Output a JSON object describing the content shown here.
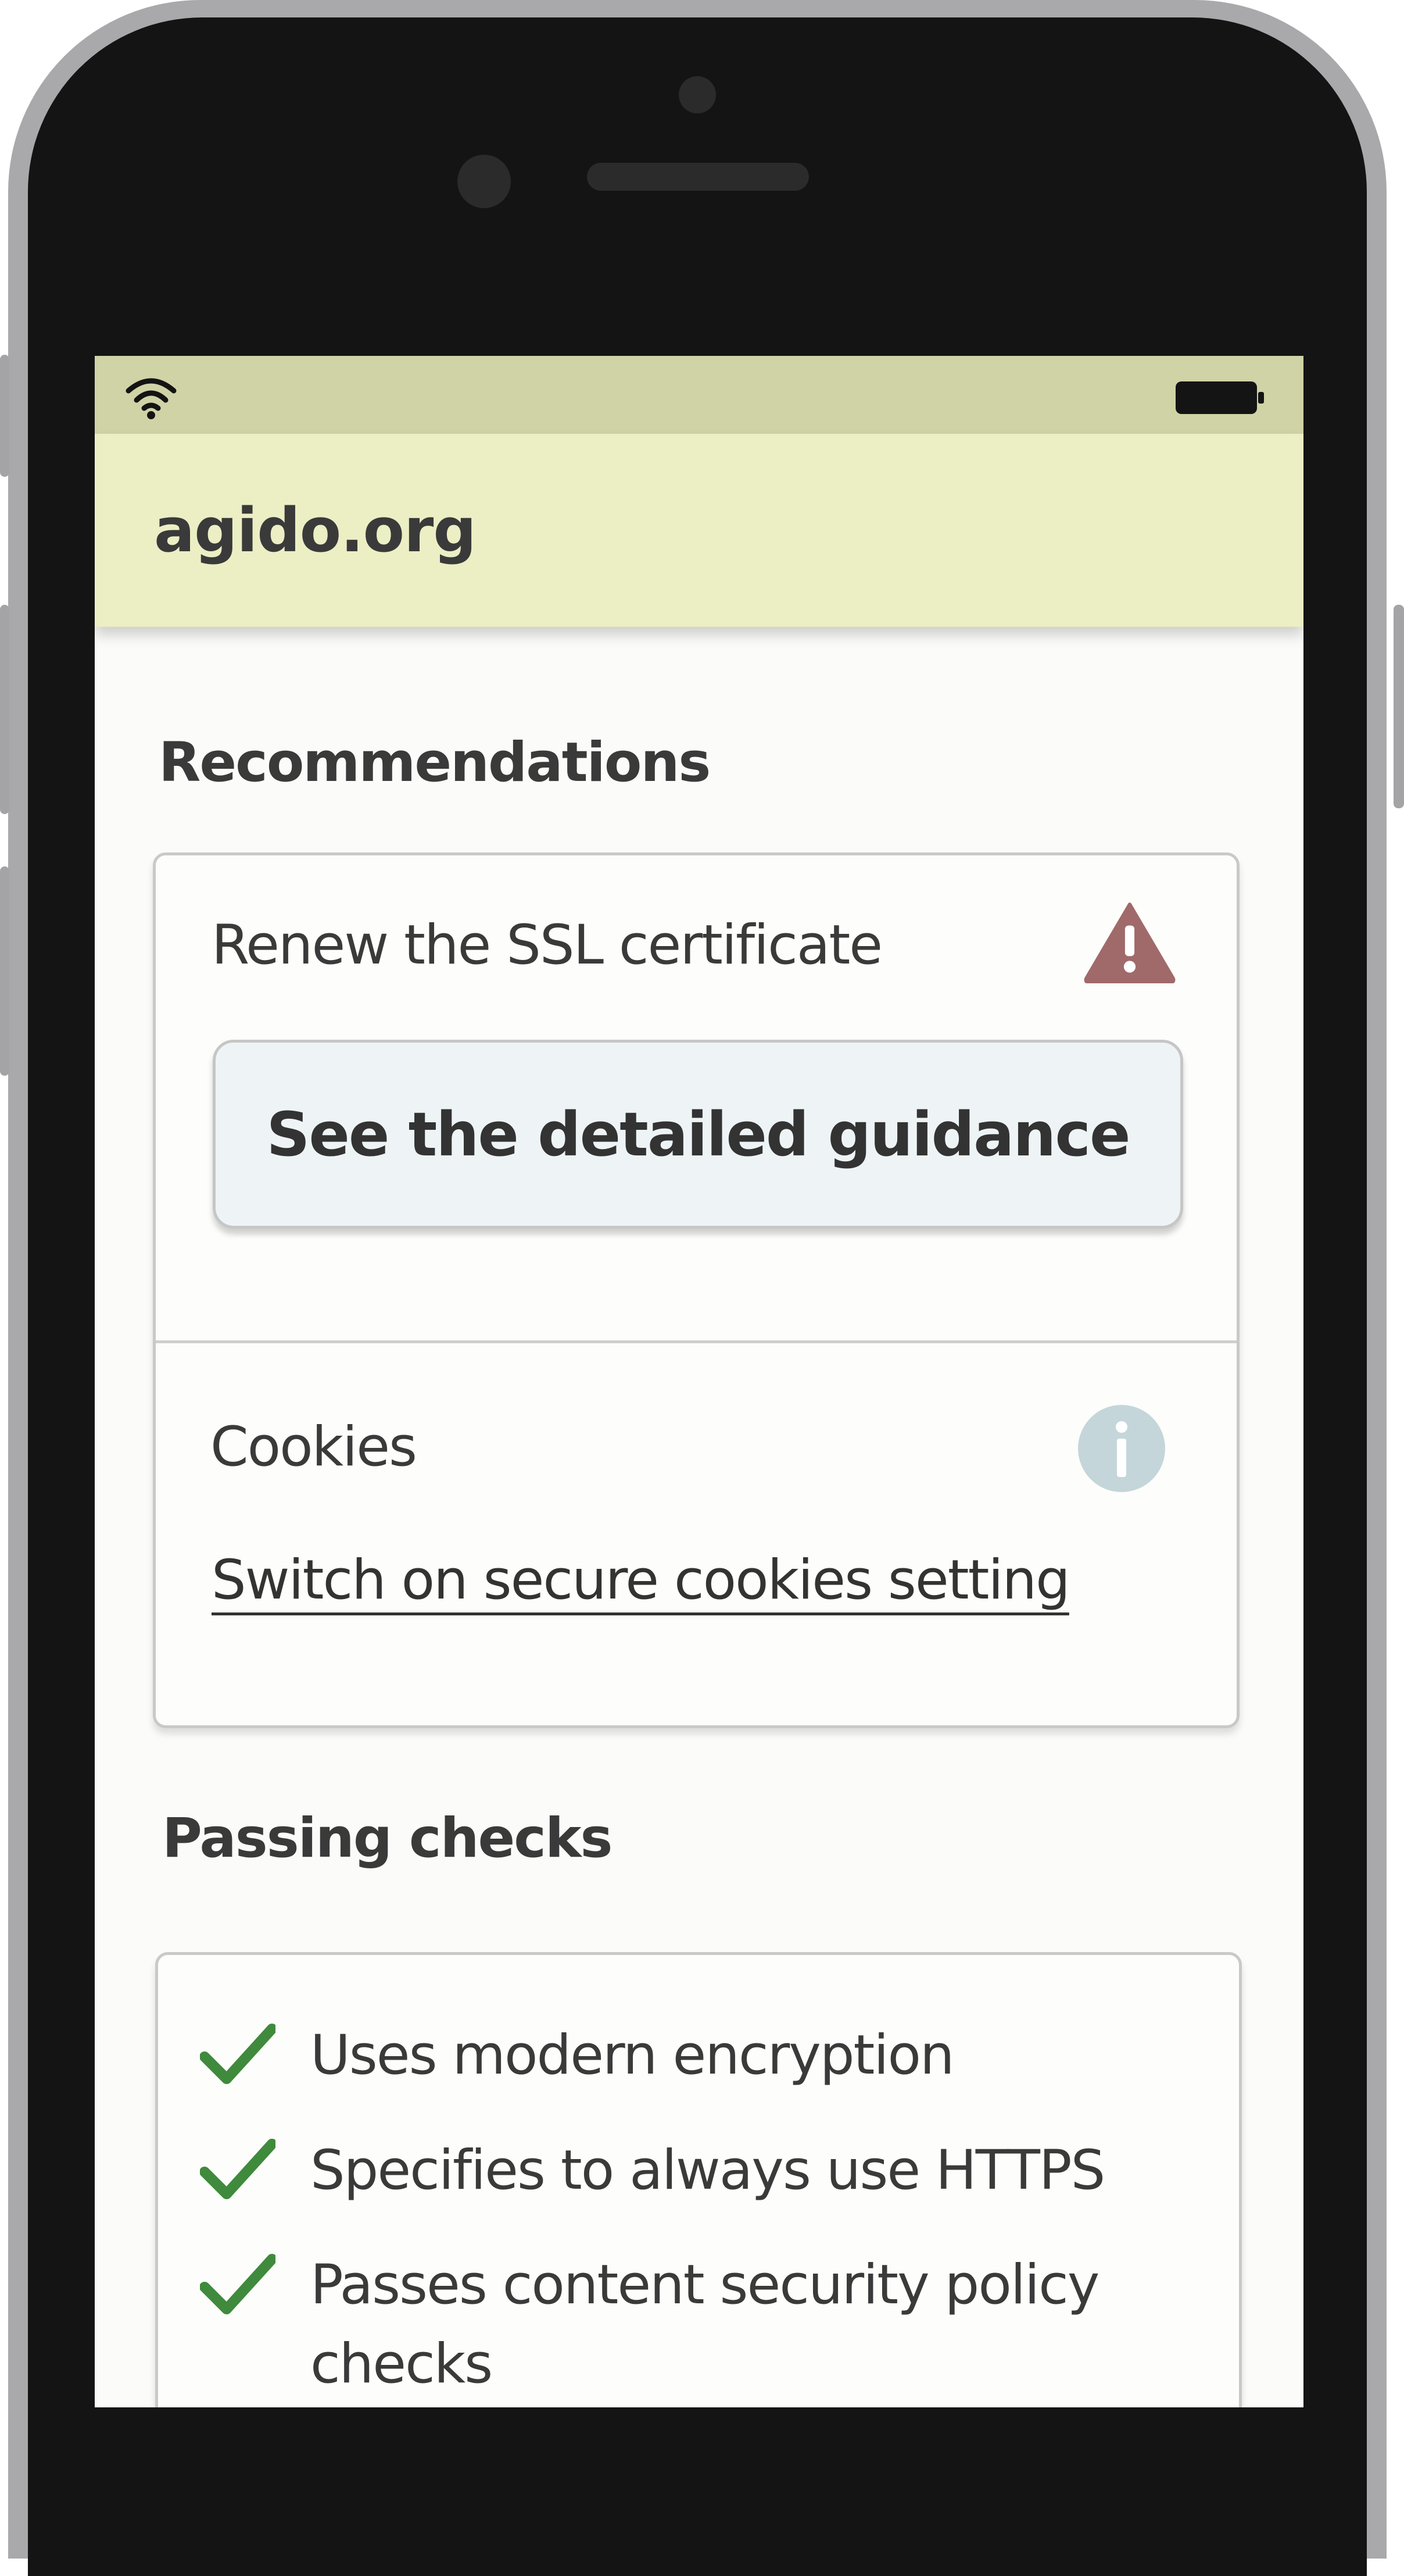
{
  "site": {
    "title": "agido.org"
  },
  "recommendations": {
    "heading": "Recommendations",
    "ssl": {
      "title": "Renew the SSL certificate",
      "button_label": "See the detailed guidance",
      "icon": "warning-icon",
      "icon_color": "#a06a6a"
    },
    "cookies": {
      "title": "Cookies",
      "link_label": "Switch on secure cookies setting",
      "icon": "info-icon",
      "icon_color": "#c4d6da"
    }
  },
  "passing": {
    "heading": "Passing checks",
    "check_color": "#3f8a3c",
    "items": [
      {
        "label": "Uses modern encryption"
      },
      {
        "label": "Specifies to always use HTTPS"
      },
      {
        "label": "Passes content security policy checks"
      }
    ]
  },
  "colors": {
    "status_bar": "#d0d3a5",
    "app_bar": "#eceec4",
    "screen_bg": "#fbfbf9"
  }
}
